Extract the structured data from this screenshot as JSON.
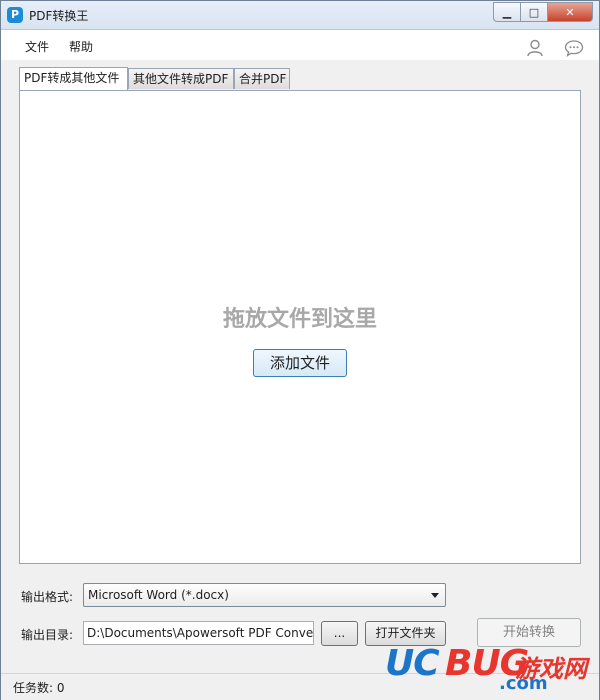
{
  "window": {
    "title": "PDF转换王",
    "minimize_glyph": "▁",
    "maximize_glyph": "□",
    "close_glyph": "✕"
  },
  "menu": {
    "file": "文件",
    "help": "帮助"
  },
  "tabs": [
    {
      "label": "PDF转成其他文件",
      "active": true
    },
    {
      "label": "其他文件转成PDF",
      "active": false
    },
    {
      "label": "合并PDF",
      "active": false
    }
  ],
  "drop_area": {
    "hint": "拖放文件到这里",
    "add_button": "添加文件"
  },
  "form": {
    "format_label": "输出格式:",
    "format_value": "Microsoft Word (*.docx)",
    "dir_label": "输出目录:",
    "dir_value": "D:\\Documents\\Apowersoft PDF Conver",
    "browse_button": "...",
    "open_folder_button": "打开文件夹",
    "start_button": "开始转换"
  },
  "status": {
    "task_count": "任务数: 0"
  },
  "watermark": {
    "uc": "UC",
    "bug": "BUG",
    "cn": "游戏网",
    "com": ".com"
  },
  "icons": {
    "app": "pdf-app-icon",
    "user": "user-icon",
    "chat": "chat-bubble-icon"
  },
  "colors": {
    "accent": "#1a8cd8",
    "close_button": "#c7432c",
    "drop_hint": "#a8a8a8"
  }
}
